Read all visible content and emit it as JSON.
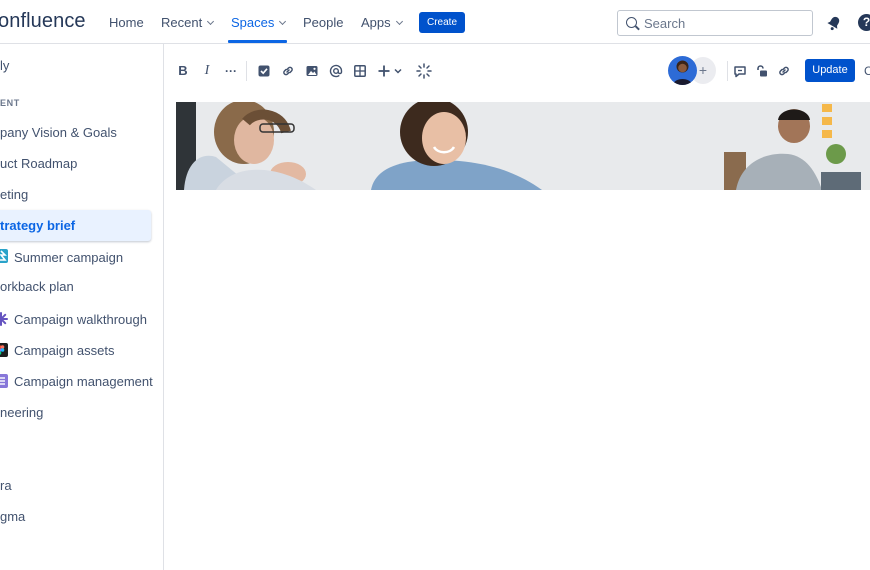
{
  "nav": {
    "logo": "onfluence",
    "items": [
      {
        "label": "Home",
        "dropdown": false
      },
      {
        "label": "Recent",
        "dropdown": true
      },
      {
        "label": "Spaces",
        "dropdown": true,
        "active": true
      },
      {
        "label": "People",
        "dropdown": false
      },
      {
        "label": "Apps",
        "dropdown": true
      }
    ],
    "create_label": "Create",
    "search_placeholder": "Search",
    "help_glyph": "?"
  },
  "sidebar": {
    "space_name": "ly",
    "section_heading": "ENT",
    "items": [
      {
        "label": "pany Vision & Goals"
      },
      {
        "label": "uct Roadmap"
      },
      {
        "label": "eting"
      },
      {
        "label": "trategy brief",
        "active": true
      },
      {
        "label": "Summer campaign",
        "icon": "summer-campaign-icon"
      },
      {
        "label": "orkback plan"
      },
      {
        "label": "Campaign walkthrough",
        "icon": "walkthrough-icon"
      },
      {
        "label": "Campaign assets",
        "icon": "figma-icon"
      },
      {
        "label": "Campaign management",
        "icon": "list-icon"
      },
      {
        "label": "neering"
      },
      {
        "label": "ra"
      },
      {
        "label": "gma"
      }
    ]
  },
  "toolbar": {
    "bold": "B",
    "italic": "I",
    "more": "···",
    "update_label": "Update",
    "close_partial": "C"
  },
  "colors": {
    "brand_blue": "#0052cc",
    "active_blue": "#0c66e4",
    "active_bg": "#e9f2ff",
    "text": "#42526e"
  }
}
